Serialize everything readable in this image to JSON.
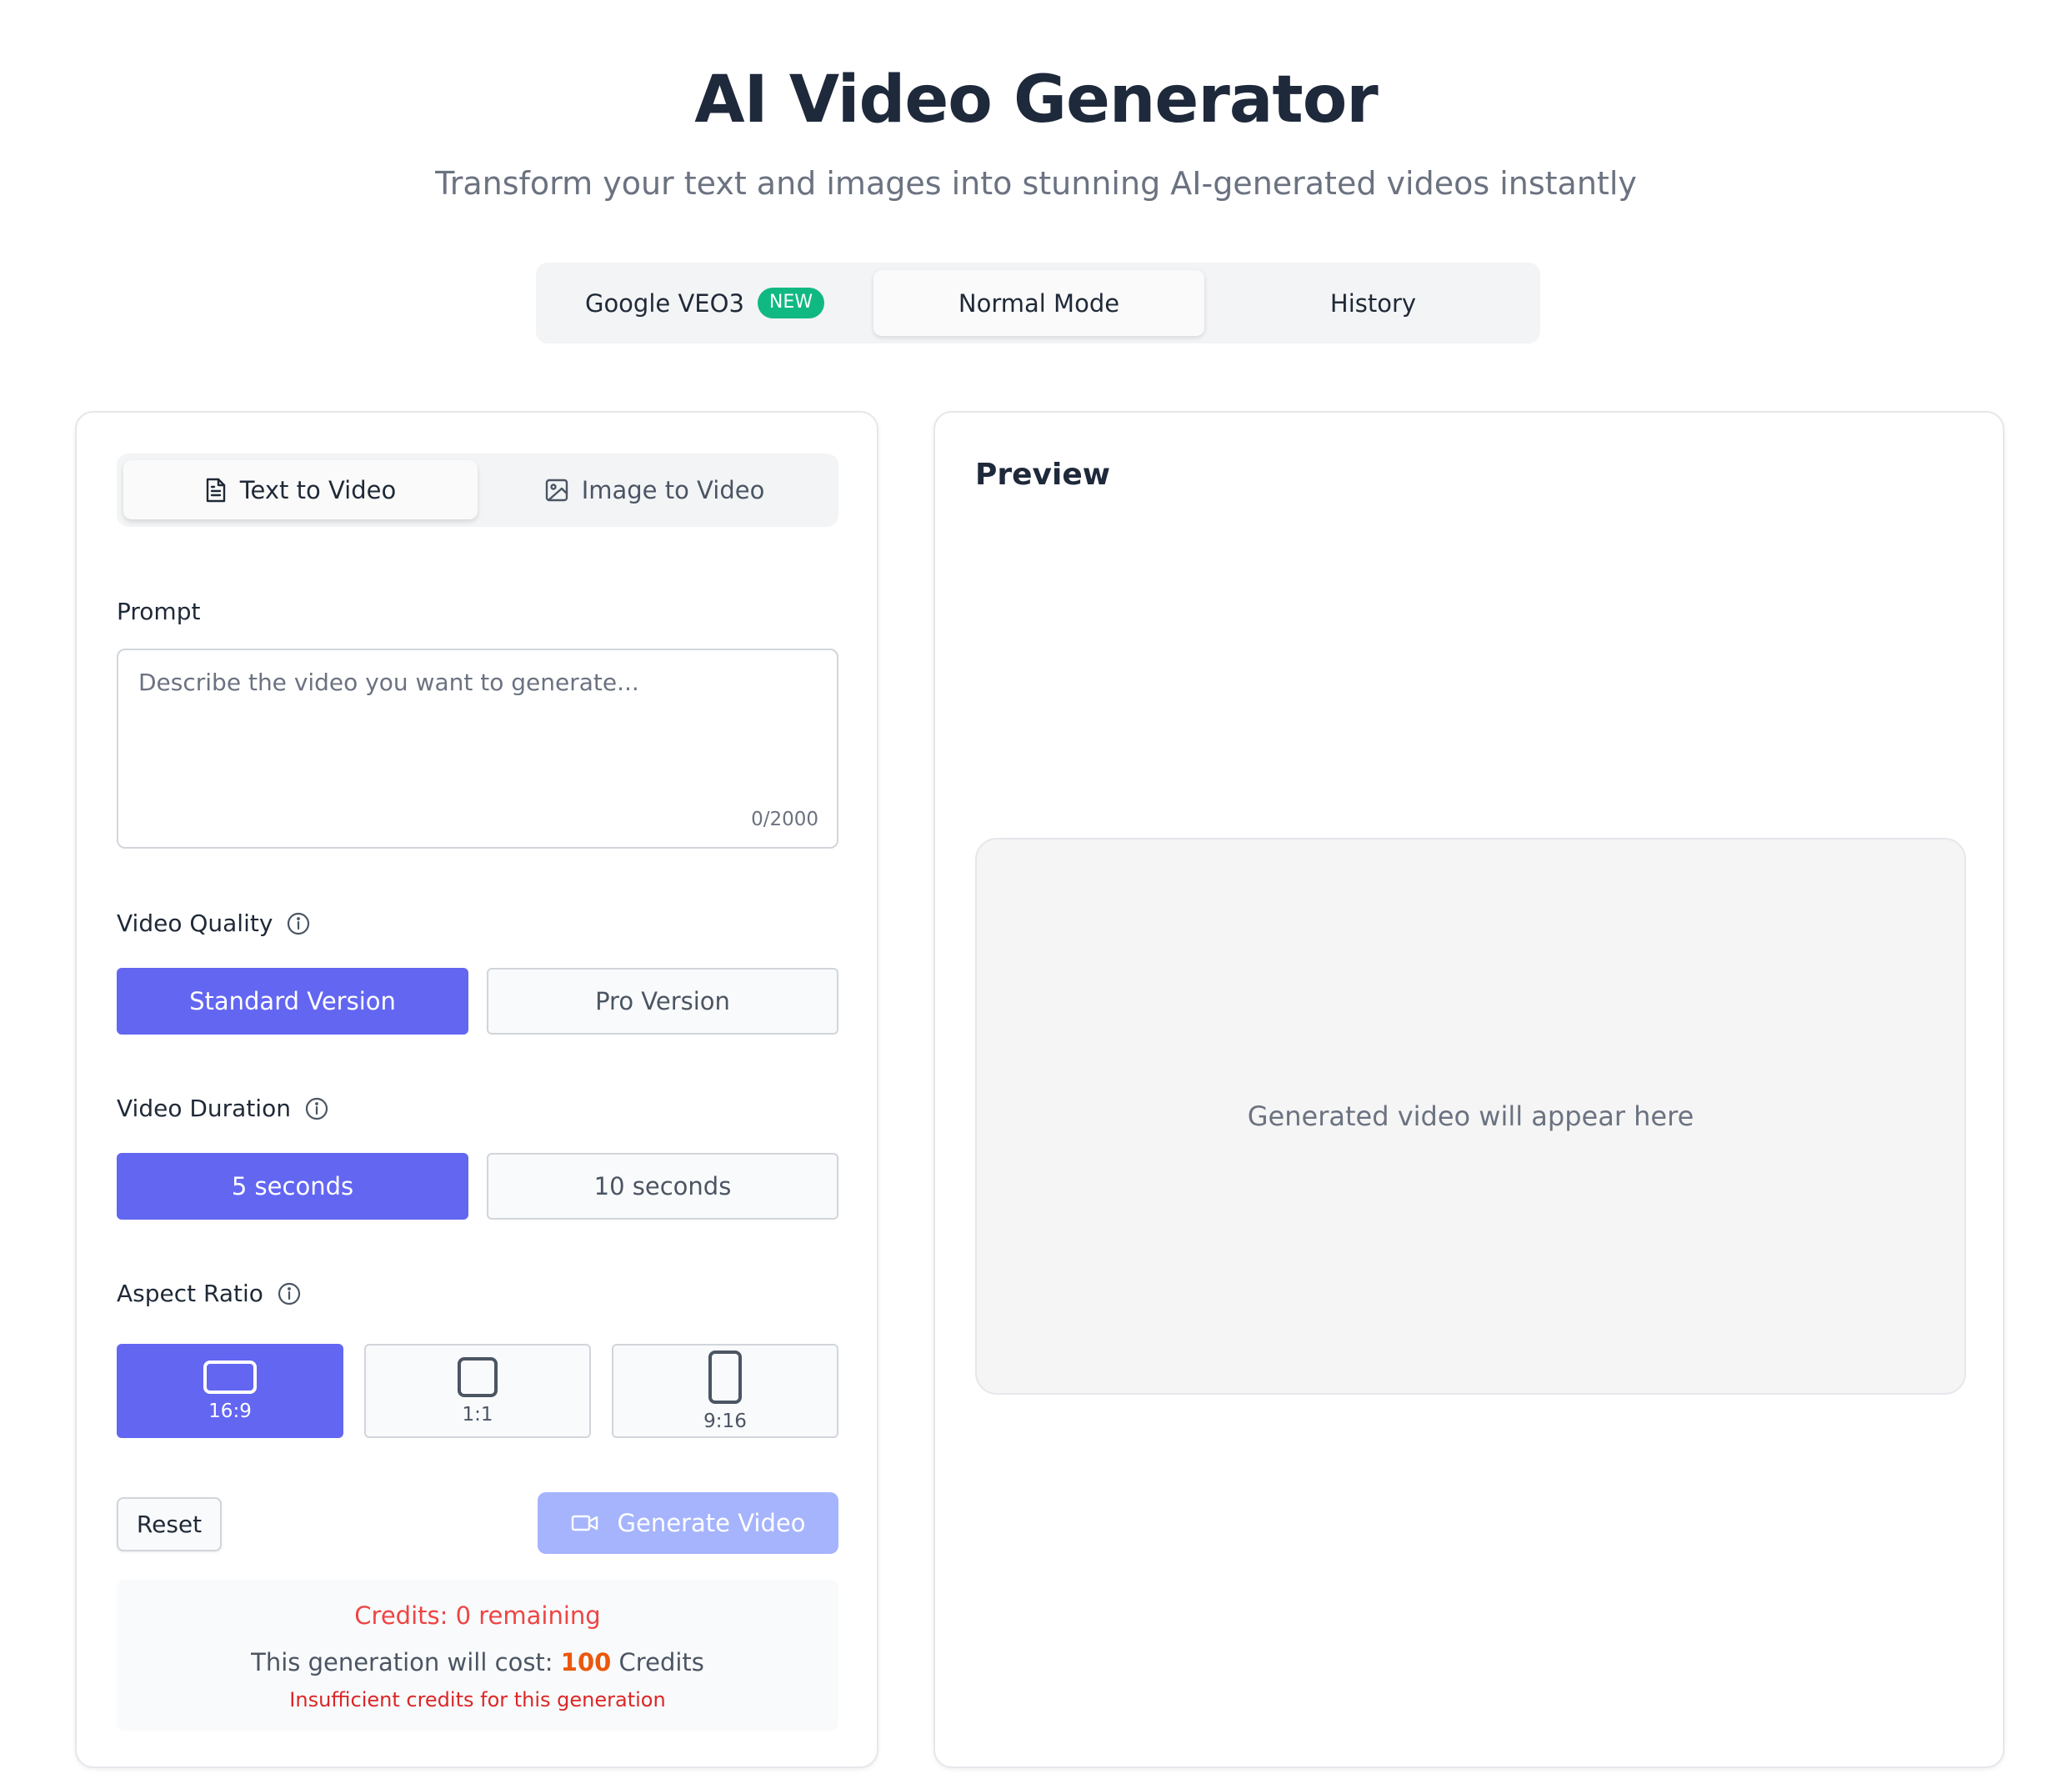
{
  "header": {
    "title": "AI Video Generator",
    "subtitle": "Transform your text and images into stunning AI-generated videos instantly"
  },
  "mode_tabs": [
    {
      "label": "Google VEO3",
      "badge": "NEW",
      "active": false
    },
    {
      "label": "Normal Mode",
      "active": true
    },
    {
      "label": "History",
      "active": false
    }
  ],
  "input_tabs": [
    {
      "label": "Text to Video",
      "icon": "document-icon",
      "active": true
    },
    {
      "label": "Image to Video",
      "icon": "image-icon",
      "active": false
    }
  ],
  "prompt": {
    "label": "Prompt",
    "placeholder": "Describe the video you want to generate...",
    "value": "",
    "char_count": "0/2000"
  },
  "quality": {
    "label": "Video Quality",
    "options": [
      "Standard Version",
      "Pro Version"
    ],
    "selected": "Standard Version"
  },
  "duration": {
    "label": "Video Duration",
    "options": [
      "5 seconds",
      "10 seconds"
    ],
    "selected": "5 seconds"
  },
  "aspect_ratio": {
    "label": "Aspect Ratio",
    "options": [
      "16:9",
      "1:1",
      "9:16"
    ],
    "selected": "16:9"
  },
  "actions": {
    "reset_label": "Reset",
    "generate_label": "Generate Video"
  },
  "credits": {
    "remaining_text": "Credits: 0 remaining",
    "cost_prefix": "This generation will cost: ",
    "cost_value": "100",
    "cost_suffix": " Credits",
    "warning": "Insufficient credits for this generation"
  },
  "preview": {
    "title": "Preview",
    "placeholder": "Generated video will appear here"
  },
  "colors": {
    "accent": "#6366f1",
    "accent_disabled": "#a5b4fc",
    "badge_green": "#10b981",
    "error_red": "#ef4444",
    "cost_orange": "#ea580c"
  }
}
